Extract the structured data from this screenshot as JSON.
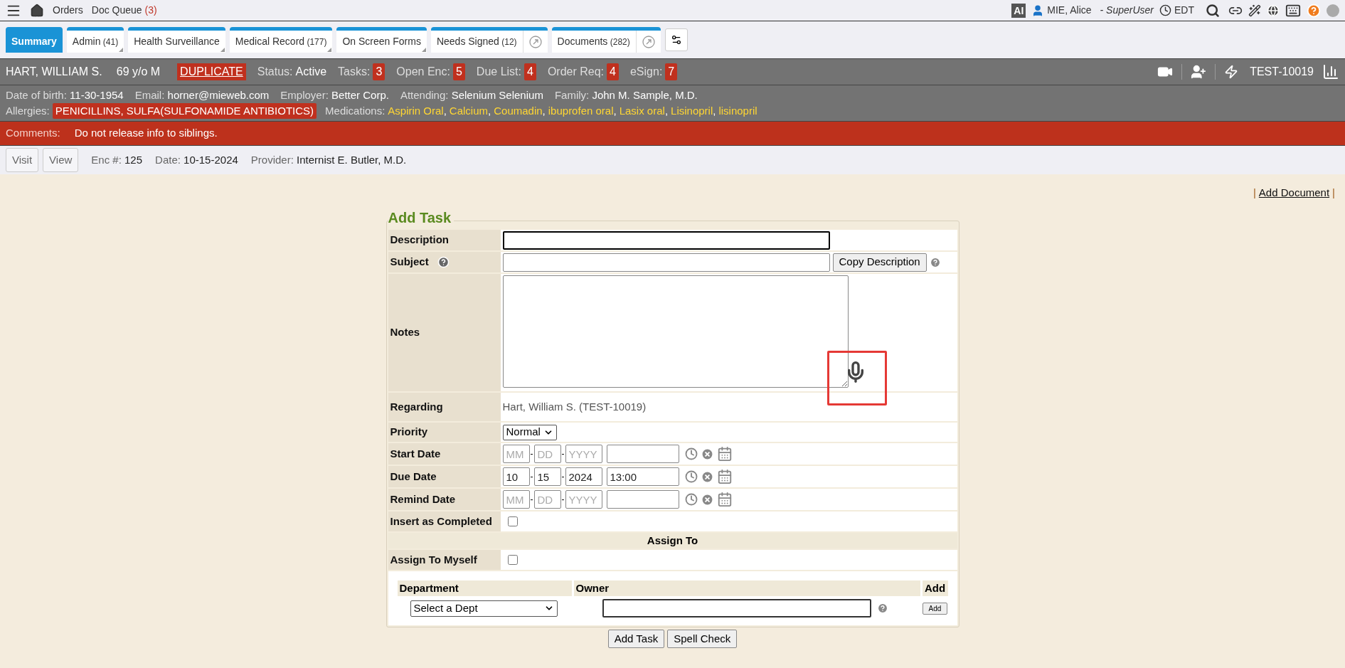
{
  "top_bar": {
    "links": [
      {
        "label": "Orders"
      },
      {
        "label": "Doc Queue",
        "count": "(3)"
      }
    ],
    "ai_badge": "AI",
    "user": "MIE, Alice",
    "role": "- SuperUser",
    "timezone": "EDT"
  },
  "tabs": [
    {
      "label": "Summary",
      "selected": true,
      "menu": false,
      "popout": false
    },
    {
      "label": "Admin",
      "count": "(41)",
      "selected": false,
      "menu": true,
      "popout": false
    },
    {
      "label": "Health Surveillance",
      "selected": false,
      "menu": true,
      "popout": false
    },
    {
      "label": "Medical Record",
      "count": "(177)",
      "selected": false,
      "menu": true,
      "popout": false
    },
    {
      "label": "On Screen Forms",
      "selected": false,
      "menu": true,
      "popout": false
    },
    {
      "label": "Needs Signed",
      "count": "(12)",
      "selected": false,
      "menu": false,
      "popout": true
    },
    {
      "label": "Documents",
      "count": "(282)",
      "selected": false,
      "menu": false,
      "popout": true
    }
  ],
  "patient": {
    "name": "HART, WILLIAM S.",
    "age": "69 y/o M",
    "flag": "DUPLICATE",
    "stats": [
      {
        "kind": "text",
        "label": "Status:",
        "value": "Active"
      },
      {
        "kind": "badge",
        "label": "Tasks:",
        "value": "3"
      },
      {
        "kind": "badge",
        "label": "Open Enc:",
        "value": "5"
      },
      {
        "kind": "badge",
        "label": "Due List:",
        "value": "4"
      },
      {
        "kind": "badge",
        "label": "Order Req:",
        "value": "4"
      },
      {
        "kind": "badge",
        "label": "eSign:",
        "value": "7"
      }
    ],
    "mrn": "TEST-10019"
  },
  "details": [
    {
      "label": "Date of birth:",
      "value": "11-30-1954"
    },
    {
      "label": "Email:",
      "value": "horner@mieweb.com"
    },
    {
      "label": "Employer:",
      "value": "Better Corp."
    },
    {
      "label": "Attending:",
      "value": "Selenium Selenium"
    },
    {
      "label": "Family:",
      "value": "John M. Sample, M.D."
    }
  ],
  "allergies": {
    "label": "Allergies:",
    "value": "PENICILLINS, SULFA(SULFONAMIDE ANTIBIOTICS)"
  },
  "medications": {
    "label": "Medications:",
    "items": [
      "Aspirin Oral",
      "Calcium",
      "Coumadin",
      "ibuprofen oral",
      "Lasix oral",
      "Lisinopril",
      "lisinopril"
    ],
    "separator": ","
  },
  "comments": {
    "label": "Comments:",
    "text": "Do not release info to siblings."
  },
  "encounter": {
    "buttons": [
      "Visit",
      "View"
    ],
    "fields": [
      {
        "label": "Enc #:",
        "value": "125"
      },
      {
        "label": "Date:",
        "value": "10-15-2024"
      },
      {
        "label": "Provider:",
        "value": "Internist E. Butler, M.D."
      }
    ]
  },
  "document_links": {
    "divider": "|",
    "link": "Add Document"
  },
  "form": {
    "title": "Add Task",
    "rows": [
      {
        "kind": "text",
        "label": "Description",
        "focused": true
      },
      {
        "kind": "subject",
        "label": "Subject",
        "button": "Copy Description"
      },
      {
        "kind": "notes",
        "label": "Notes",
        "highlighted": true
      },
      {
        "kind": "static",
        "label": "Regarding",
        "value": "Hart, William S. (TEST-10019)"
      },
      {
        "kind": "select",
        "label": "Priority",
        "value": "Normal"
      },
      {
        "kind": "date",
        "label": "Start Date",
        "separator": "-",
        "parts": [
          {
            "placeholder": "MM"
          },
          {
            "placeholder": "DD"
          },
          {
            "placeholder": "YYYY"
          }
        ]
      },
      {
        "kind": "date",
        "label": "Due Date",
        "separator": "-",
        "parts": [
          {
            "value": "10"
          },
          {
            "value": "15"
          },
          {
            "value": "2024"
          }
        ],
        "time": "13:00"
      },
      {
        "kind": "date",
        "label": "Remind Date",
        "separator": "-",
        "parts": [
          {
            "placeholder": "MM"
          },
          {
            "placeholder": "DD"
          },
          {
            "placeholder": "YYYY"
          }
        ]
      },
      {
        "kind": "checkbox",
        "label": "Insert as Completed",
        "checked": false
      },
      {
        "kind": "header",
        "label": "Assign To"
      },
      {
        "kind": "checkbox",
        "label": "Assign To Myself",
        "checked": false
      }
    ],
    "assignment": {
      "columns": [
        "Department",
        "Owner",
        "Add"
      ],
      "department": "Select a Dept",
      "add_button": "Add"
    },
    "buttons": [
      "Add Task",
      "Spell Check"
    ]
  }
}
